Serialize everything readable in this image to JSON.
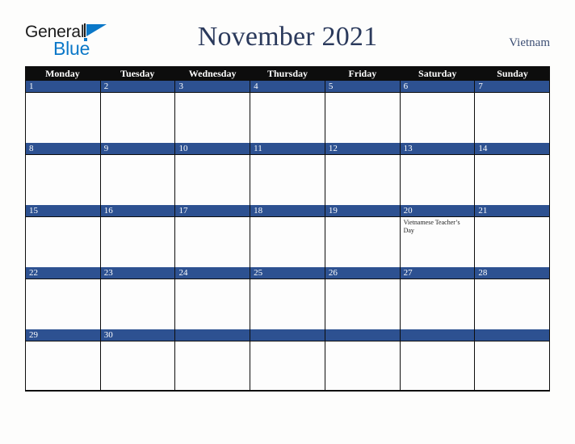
{
  "brand": {
    "name_part1": "General",
    "name_part2": "Blue",
    "accent_color": "#0b78c8"
  },
  "header": {
    "title": "November 2021",
    "country": "Vietnam",
    "title_color": "#2b3a5c",
    "country_color": "#3d4f74"
  },
  "theme": {
    "dow_header_bg": "#0d0d0d",
    "date_bar_bg": "#2d5191",
    "cell_bg": "#fdfdfd",
    "page_bg": "#fdfdfc",
    "grid_line": "#0d0d0d"
  },
  "calendar": {
    "day_names": [
      "Monday",
      "Tuesday",
      "Wednesday",
      "Thursday",
      "Friday",
      "Saturday",
      "Sunday"
    ],
    "weeks": [
      [
        {
          "date": "1",
          "events": []
        },
        {
          "date": "2",
          "events": []
        },
        {
          "date": "3",
          "events": []
        },
        {
          "date": "4",
          "events": []
        },
        {
          "date": "5",
          "events": []
        },
        {
          "date": "6",
          "events": []
        },
        {
          "date": "7",
          "events": []
        }
      ],
      [
        {
          "date": "8",
          "events": []
        },
        {
          "date": "9",
          "events": []
        },
        {
          "date": "10",
          "events": []
        },
        {
          "date": "11",
          "events": []
        },
        {
          "date": "12",
          "events": []
        },
        {
          "date": "13",
          "events": []
        },
        {
          "date": "14",
          "events": []
        }
      ],
      [
        {
          "date": "15",
          "events": []
        },
        {
          "date": "16",
          "events": []
        },
        {
          "date": "17",
          "events": []
        },
        {
          "date": "18",
          "events": []
        },
        {
          "date": "19",
          "events": []
        },
        {
          "date": "20",
          "events": [
            "Vietnamese Teacher’s Day"
          ]
        },
        {
          "date": "21",
          "events": []
        }
      ],
      [
        {
          "date": "22",
          "events": []
        },
        {
          "date": "23",
          "events": []
        },
        {
          "date": "24",
          "events": []
        },
        {
          "date": "25",
          "events": []
        },
        {
          "date": "26",
          "events": []
        },
        {
          "date": "27",
          "events": []
        },
        {
          "date": "28",
          "events": []
        }
      ],
      [
        {
          "date": "29",
          "events": []
        },
        {
          "date": "30",
          "events": []
        },
        {
          "date": "",
          "events": []
        },
        {
          "date": "",
          "events": []
        },
        {
          "date": "",
          "events": []
        },
        {
          "date": "",
          "events": []
        },
        {
          "date": "",
          "events": []
        }
      ]
    ]
  }
}
